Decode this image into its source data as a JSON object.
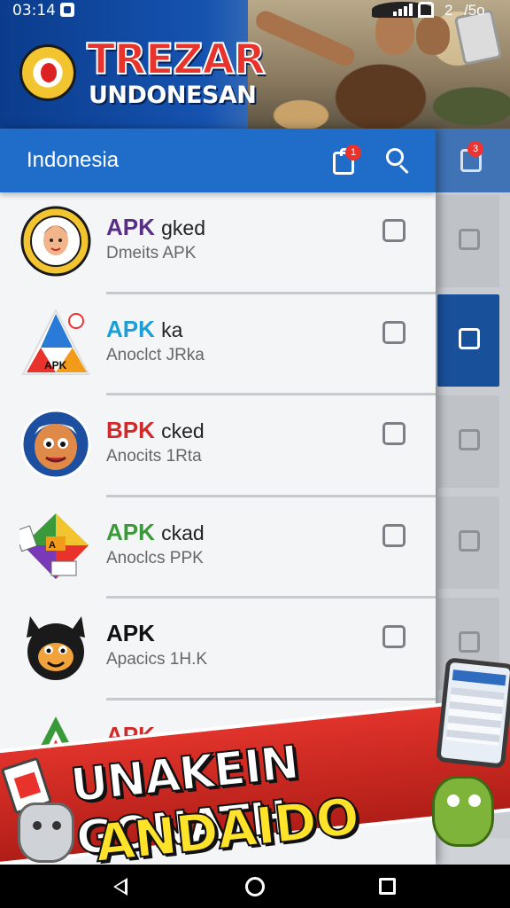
{
  "status_bar": {
    "time": "03:14",
    "network": "2",
    "battery": "/5o"
  },
  "banner": {
    "title": "TREZAR",
    "subtitle": "UNDONESAN"
  },
  "toolbar": {
    "title": "Indonesia",
    "cart_badge": "1",
    "back_cart_badge": "3"
  },
  "apps": [
    {
      "tag": "APK",
      "rest": "gked",
      "tag_color": "#5a2d86",
      "sub": "Dmeits APK",
      "checked": false,
      "icon": "face-badge-icon"
    },
    {
      "tag": "APK",
      "rest": "ka",
      "tag_color": "#1a9fd8",
      "sub": "Anoclct JRka",
      "checked": false,
      "icon": "apk-triangle-icon"
    },
    {
      "tag": "BPK",
      "rest": "cked",
      "tag_color": "#d12a2a",
      "sub": "Anocits 1Rta",
      "checked": false,
      "icon": "cartoon-face-icon"
    },
    {
      "tag": "APK",
      "rest": "ckad",
      "tag_color": "#3a9a3a",
      "sub": "Anoclcs PPK",
      "checked": false,
      "icon": "colorful-cube-icon"
    },
    {
      "tag": "APK",
      "rest": "",
      "tag_color": "#111111",
      "sub": "Apacics 1H.K",
      "checked": false,
      "icon": "black-cat-icon"
    },
    {
      "tag": "APK",
      "rest": "",
      "tag_color": "#d12a2a",
      "sub": "",
      "checked": false,
      "icon": "apk-green-triangle-icon"
    }
  ],
  "promo": {
    "line1": "UNAKEIN GONATH",
    "line2": "ANDAIDO GAA!"
  },
  "colors": {
    "toolbar": "#1f6cc9",
    "accent_red": "#e8322b",
    "promo_yellow": "#ffe22a"
  }
}
